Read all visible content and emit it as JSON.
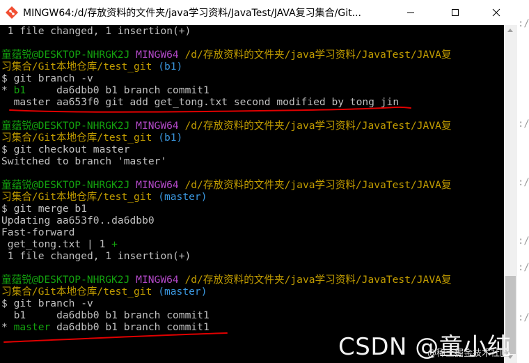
{
  "window": {
    "title": "MINGW64:/d/存放资料的文件夹/java学习资料/JavaTest/JAVA复习集合/Git..."
  },
  "terminal": {
    "block0": {
      "summary": " 1 file changed, 1 insertion(+)"
    },
    "block1": {
      "user": "童蕴锐@DESKTOP-NHRGK2J",
      "shell": "MINGW64",
      "path1": "/d/存放资料的文件夹/java学习资料/JavaTest/JAVA复",
      "path2": "习集合/Git本地仓库/test_git",
      "branch": "(b1)",
      "cmd": "$ git branch -v",
      "out1_marker": "* ",
      "out1_name": "b1",
      "out1_rest": "     da6dbb0 b1 branch commit1",
      "out2": "  master aa653f0 git add get_tong.txt second modified by tong jin"
    },
    "block2": {
      "user": "童蕴锐@DESKTOP-NHRGK2J",
      "shell": "MINGW64",
      "path1": "/d/存放资料的文件夹/java学习资料/JavaTest/JAVA复",
      "path2": "习集合/Git本地仓库/test_git",
      "branch": "(b1)",
      "cmd": "$ git checkout master",
      "out1": "Switched to branch 'master'"
    },
    "block3": {
      "user": "童蕴锐@DESKTOP-NHRGK2J",
      "shell": "MINGW64",
      "path1": "/d/存放资料的文件夹/java学习资料/JavaTest/JAVA复",
      "path2": "习集合/Git本地仓库/test_git",
      "branch": "(master)",
      "cmd": "$ git merge b1",
      "out1": "Updating aa653f0..da6dbb0",
      "out2": "Fast-forward",
      "out3a": " get_tong.txt | 1 ",
      "out3b": "+",
      "out4": " 1 file changed, 1 insertion(+)"
    },
    "block4": {
      "user": "童蕴锐@DESKTOP-NHRGK2J",
      "shell": "MINGW64",
      "path1": "/d/存放资料的文件夹/java学习资料/JavaTest/JAVA复",
      "path2": "习集合/Git本地仓库/test_git",
      "branch": "(master)",
      "cmd": "$ git branch -v",
      "out1": "  b1     da6dbb0 b1 branch commit1",
      "out2_marker": "* ",
      "out2_name": "master",
      "out2_rest": " da6dbb0 b1 branch commit1"
    }
  },
  "background_window": {
    "glyph": ":/"
  },
  "watermark": {
    "main": "CSDN @童小纯",
    "sub": "@稀土掘金技术社区"
  },
  "colors": {
    "terminal_bg": "#000000",
    "text": "#c0c0c0",
    "prompt_user": "#13a10e",
    "prompt_shell": "#b148c6",
    "prompt_path": "#c19c00",
    "prompt_branch": "#3a96dd",
    "annotation": "#e00000"
  }
}
